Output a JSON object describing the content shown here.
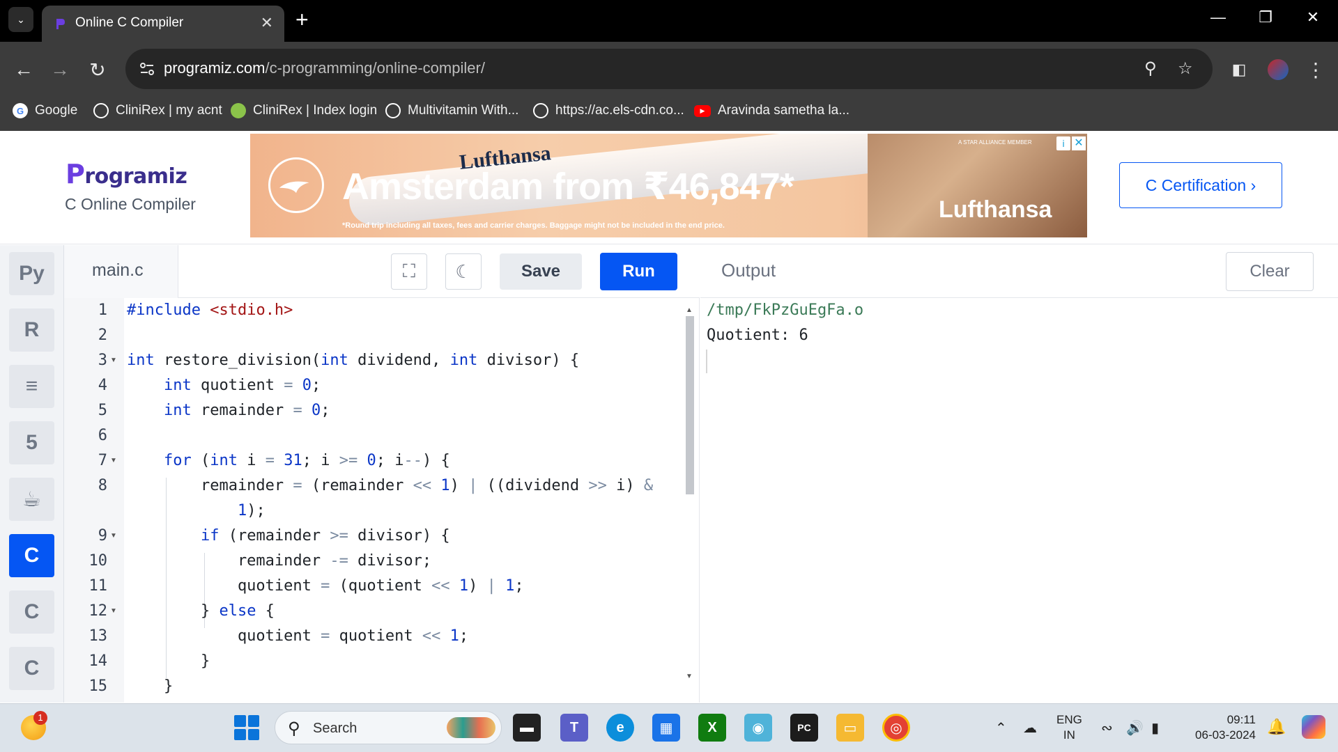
{
  "browser": {
    "tab_title": "Online C Compiler",
    "tab_close_glyph": "✕",
    "new_tab_glyph": "+",
    "window_controls": {
      "minimize": "—",
      "restore": "❐",
      "close": "✕"
    },
    "url_domain": "programiz.com",
    "url_path": "/c-programming/online-compiler/",
    "bookmarks": [
      {
        "label": "Google",
        "icon": "google-icon",
        "color": "#4285f4"
      },
      {
        "label": "CliniRex | my acnt",
        "icon": "globe-icon",
        "color": "#ffffff"
      },
      {
        "label": "CliniRex | Index login",
        "icon": "clinirex-icon",
        "color": "#8bc34a"
      },
      {
        "label": "Multivitamin With...",
        "icon": "globe-icon",
        "color": "#ffffff"
      },
      {
        "label": "https://ac.els-cdn.co...",
        "icon": "globe-icon",
        "color": "#ffffff"
      },
      {
        "label": "Aravinda sametha la...",
        "icon": "youtube-icon",
        "color": "#ff0000"
      }
    ]
  },
  "header": {
    "logo_initial": "P",
    "logo_rest": "rogramiz",
    "compiler_name": "C Online Compiler",
    "certification_button": "C Certification ›"
  },
  "ad": {
    "airline_small": "Lufthansa",
    "headline": "Amsterdam from ₹46,847*",
    "fine_print": "*Round trip including all taxes, fees and carrier charges. Baggage might not be included in the end price.",
    "member_text": "A STAR ALLIANCE MEMBER",
    "airline": "Lufthansa",
    "info_glyph": "i",
    "close_glyph": "✕"
  },
  "languages": [
    {
      "name": "python-icon",
      "glyph": "Py",
      "active": false
    },
    {
      "name": "r-icon",
      "glyph": "R",
      "active": false
    },
    {
      "name": "sql-icon",
      "glyph": "≡",
      "active": false
    },
    {
      "name": "html5-icon",
      "glyph": "5",
      "active": false
    },
    {
      "name": "java-icon",
      "glyph": "☕",
      "active": false
    },
    {
      "name": "c-icon",
      "glyph": "C",
      "active": true
    },
    {
      "name": "cpp-icon",
      "glyph": "C",
      "active": false
    },
    {
      "name": "csharp-icon",
      "glyph": "C",
      "active": false
    }
  ],
  "editor": {
    "file_name": "main.c",
    "save_label": "Save",
    "run_label": "Run",
    "fullscreen_glyph": "⛶",
    "theme_glyph": "☾",
    "line_numbers": [
      "1",
      "2",
      "3",
      "4",
      "5",
      "6",
      "7",
      "8",
      "",
      "9",
      "10",
      "11",
      "12",
      "13",
      "14",
      "15"
    ],
    "folded_lines": [
      3,
      7,
      9,
      12
    ]
  },
  "output": {
    "title": "Output",
    "clear_label": "Clear",
    "path": "/tmp/FkPzGuEgFa.o",
    "result": "Quotient: 6"
  },
  "taskbar": {
    "weather_badge": "1",
    "search_label": "Search",
    "lang_line1": "ENG",
    "lang_line2": "IN",
    "time": "09:11",
    "date": "06-03-2024",
    "apps": [
      {
        "name": "file-explorer-dark-icon",
        "color": "#222222",
        "glyph": "▬"
      },
      {
        "name": "teams-icon",
        "color": "#5b5fc7",
        "glyph": "T"
      },
      {
        "name": "edge-icon",
        "color": "#0c8edb",
        "glyph": "e"
      },
      {
        "name": "store-icon",
        "color": "#1a73e8",
        "glyph": "▦"
      },
      {
        "name": "xbox-icon",
        "color": "#107c10",
        "glyph": "X"
      },
      {
        "name": "photos-icon",
        "color": "#4fb3d9",
        "glyph": "◉"
      },
      {
        "name": "pycharm-icon",
        "color": "#1c1c1c",
        "glyph": "PC"
      },
      {
        "name": "folder-icon",
        "color": "#f5b932",
        "glyph": "▭"
      },
      {
        "name": "chrome-icon",
        "color": "#e34133",
        "glyph": "◎"
      }
    ]
  }
}
